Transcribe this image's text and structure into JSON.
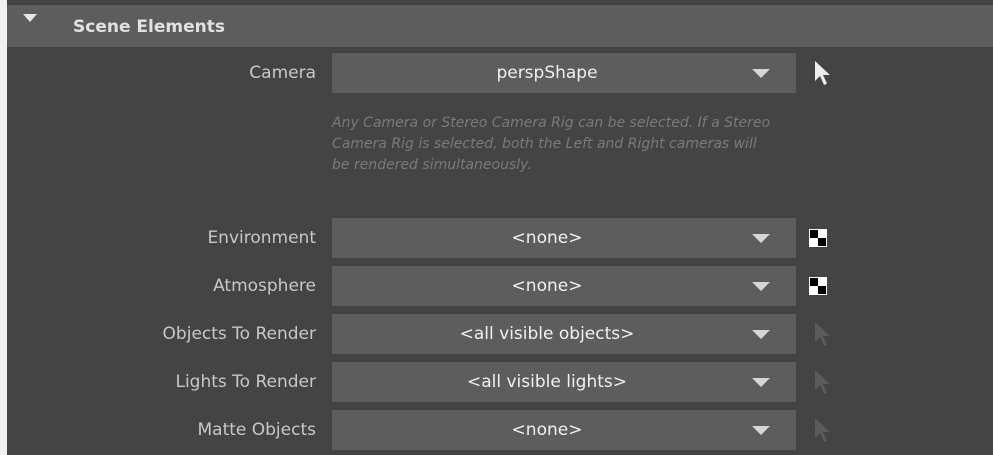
{
  "section": {
    "title": "Scene Elements"
  },
  "camera": {
    "label": "Camera",
    "value": "perspShape",
    "description": "Any Camera or Stereo Camera Rig can be selected. If a Stereo Camera Rig is selected, both the Left and Right cameras will be rendered simultaneously."
  },
  "environment": {
    "label": "Environment",
    "value": "<none>"
  },
  "atmosphere": {
    "label": "Atmosphere",
    "value": "<none>"
  },
  "objects_to_render": {
    "label": "Objects To Render",
    "value": "<all visible objects>"
  },
  "lights_to_render": {
    "label": "Lights To Render",
    "value": "<all visible lights>"
  },
  "matte_objects": {
    "label": "Matte Objects",
    "value": "<none>"
  },
  "icons": {
    "collapse": "triangle-down-icon",
    "select": "arrow-cursor-icon",
    "map": "checker-icon"
  },
  "colors": {
    "panel": "#444444",
    "header": "#5d5d5d",
    "field": "#5d5d5d",
    "text": "#c8c8c8",
    "hint": "#7a7a7a"
  }
}
